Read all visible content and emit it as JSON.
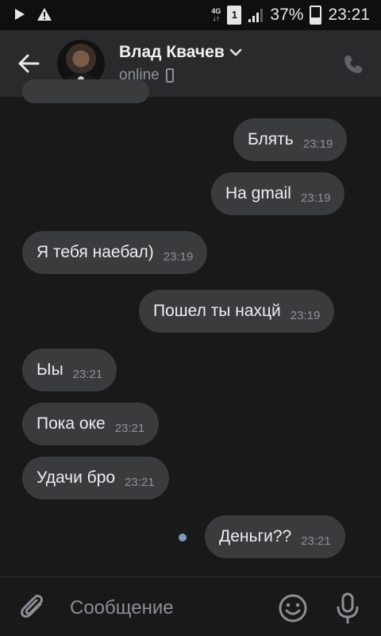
{
  "status_bar": {
    "network_top": "4G",
    "network_bottom": "↓↑",
    "sim": "1",
    "battery": "37%",
    "battery_level": 0.37,
    "time": "23:21"
  },
  "header": {
    "contact_name": "Влад Квачев",
    "status": "online"
  },
  "messages": [
    {
      "text": "Блять",
      "time": "23:19",
      "direction": "outgoing"
    },
    {
      "text": "На gmail",
      "time": "23:19",
      "direction": "outgoing"
    },
    {
      "text": "Я тебя наебал)",
      "time": "23:19",
      "direction": "incoming"
    },
    {
      "text": "Пошел ты нахцй",
      "time": "23:19",
      "direction": "outgoing"
    },
    {
      "text": "Ыы",
      "time": "23:21",
      "direction": "incoming"
    },
    {
      "text": "Пока оке",
      "time": "23:21",
      "direction": "incoming"
    },
    {
      "text": "Удачи бро",
      "time": "23:21",
      "direction": "incoming"
    },
    {
      "text": "Деньги??",
      "time": "23:21",
      "direction": "outgoing",
      "unread": true
    }
  ],
  "composer": {
    "placeholder": "Сообщение"
  },
  "colors": {
    "background": "#19191a",
    "header": "#2a2a2c",
    "bubble": "#3a3b3d",
    "unread_dot": "#7b9bc2"
  }
}
